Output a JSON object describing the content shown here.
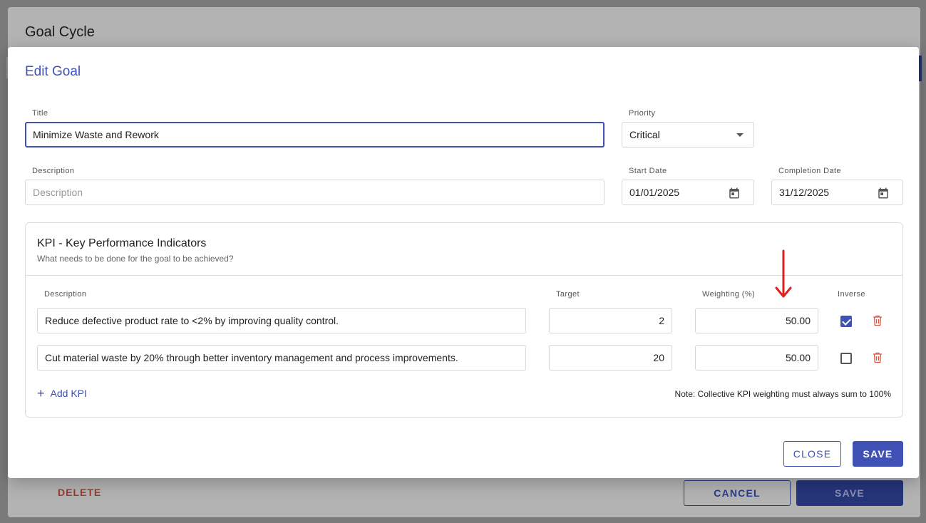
{
  "background_dialog": {
    "title": "Goal Cycle",
    "delete_label": "DELETE",
    "cancel_label": "CANCEL",
    "save_label": "SAVE"
  },
  "modal": {
    "title": "Edit Goal",
    "title_field": {
      "label": "Title",
      "value": "Minimize Waste and Rework"
    },
    "priority_field": {
      "label": "Priority",
      "value": "Critical"
    },
    "description_field": {
      "label": "Description",
      "placeholder": "Description",
      "value": ""
    },
    "start_date_field": {
      "label": "Start Date",
      "value": "01/01/2025",
      "icon": "calendar-icon"
    },
    "completion_date_field": {
      "label": "Completion Date",
      "value": "31/12/2025",
      "icon": "calendar-icon"
    },
    "kpi": {
      "title": "KPI - Key Performance Indicators",
      "subtitle": "What needs to be done for the goal to be achieved?",
      "columns": [
        "Description",
        "Target",
        "Weighting (%)",
        "Inverse"
      ],
      "rows": [
        {
          "description": "Reduce defective product rate to <2% by improving quality control.",
          "target": "2",
          "weighting": "50.00",
          "inverse": true
        },
        {
          "description": "Cut material waste by 20% through better inventory management and process improvements.",
          "target": "20",
          "weighting": "50.00",
          "inverse": false
        }
      ],
      "add_label": "Add KPI",
      "note": "Note: Collective KPI weighting must always sum to 100%"
    },
    "close_label": "CLOSE",
    "save_label": "SAVE"
  },
  "colors": {
    "accent": "#3f51b5",
    "delete": "#e0533d",
    "annotation_arrow": "#e02020"
  }
}
